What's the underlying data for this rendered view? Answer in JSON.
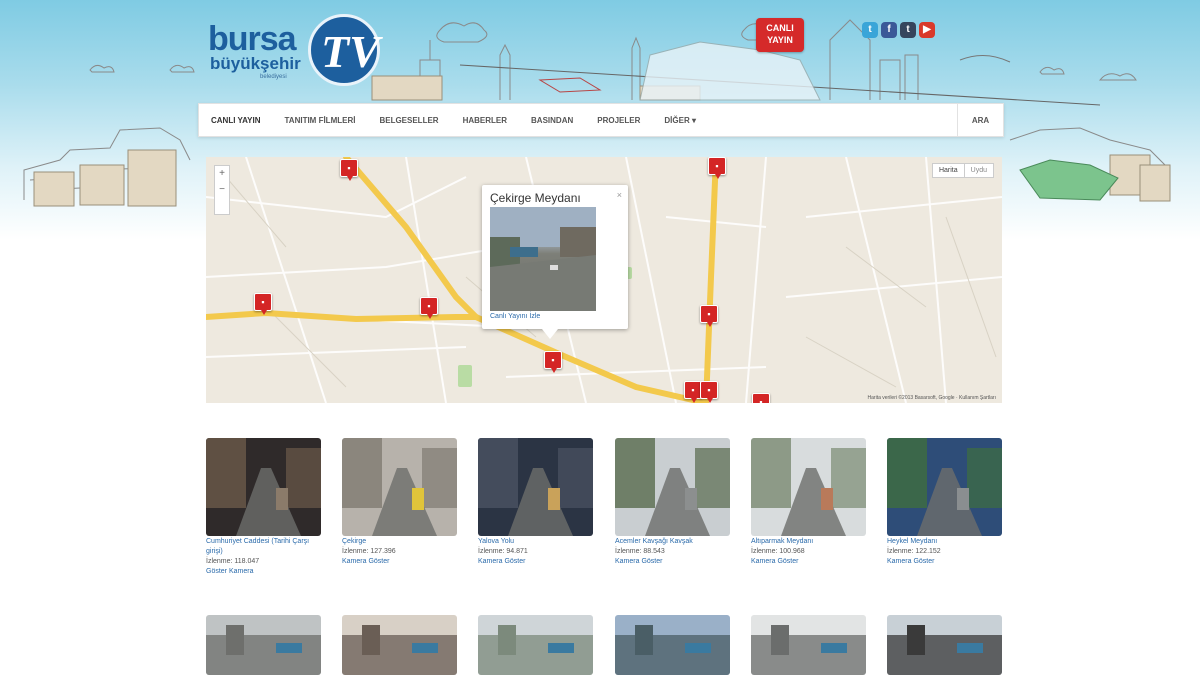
{
  "header": {
    "logo_word1": "bursa",
    "logo_word2": "büyükşehir",
    "logo_sub": "belediyesi",
    "logo_tv": "TV",
    "live_badge_line1": "CANLI",
    "live_badge_line2": "YAYIN",
    "social_icons": [
      "twitter-icon",
      "facebook-icon",
      "tumblr-icon",
      "youtube-icon"
    ],
    "social_glyphs": [
      "t",
      "f",
      "t",
      "▶"
    ],
    "social_colors": [
      "#3aa5d8",
      "#3b5998",
      "#36465d",
      "#d93a2b"
    ]
  },
  "nav": {
    "items": [
      "CANLI YAYIN",
      "TANITIM FİLMLERİ",
      "BELGESELLER",
      "HABERLER",
      "BASINDAN",
      "PROJELER",
      "DİĞER ▾"
    ],
    "search": "ARA"
  },
  "map": {
    "zoom_in": "+",
    "zoom_out": "−",
    "type_map": "Harita",
    "type_sat": "Uydu",
    "infowindow": {
      "title": "Çekirge Meydanı",
      "close": "×",
      "link": "Canlı Yayını İzle"
    },
    "attribution": "Harita verileri ©2013 Basarsoft, Google · Kullanım Şartları"
  },
  "colors": {
    "accent": "#2a6aaa",
    "marker": "#d42525",
    "road": "#f7d65a",
    "brand": "#1d5f9e"
  },
  "cameras": [
    {
      "title": "Cumhuriyet Caddesi (Tarihi Çarşı girişi)",
      "views": "İzlenme: 118.047",
      "link": "Göster Kamera"
    },
    {
      "title": "Çekirge",
      "views": "İzlenme: 127.396",
      "link": "Kamera Göster"
    },
    {
      "title": "Yalova Yolu",
      "views": "İzlenme: 94.871",
      "link": "Kamera Göster"
    },
    {
      "title": "Acemler Kavşağı Kavşak",
      "views": "İzlenme: 88.543",
      "link": "Kamera Göster"
    },
    {
      "title": "Altıparmak Meydanı",
      "views": "İzlenme: 100.968",
      "link": "Kamera Göster"
    },
    {
      "title": "Heykel Meydanı",
      "views": "İzlenme: 122.152",
      "link": "Kamera Göster"
    }
  ]
}
